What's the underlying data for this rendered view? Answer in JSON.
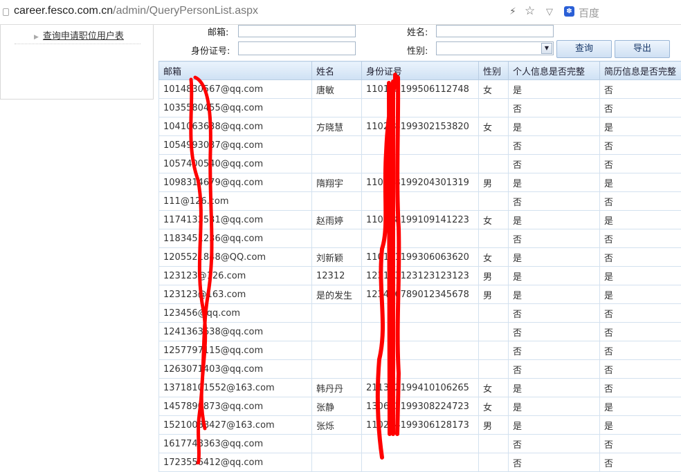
{
  "browser": {
    "url_host": "career.fesco.com.cn",
    "url_path": "/admin/QueryPersonList.aspx",
    "search_engine": "百度",
    "icons": [
      "page-icon",
      "lightning-icon",
      "star-icon",
      "chevron-down-icon",
      "baidu-paw-icon"
    ]
  },
  "sidebar": {
    "items": [
      {
        "label": "查询申请职位用户表"
      }
    ]
  },
  "form": {
    "email_label": "邮箱:",
    "email_value": "",
    "name_label": "姓名:",
    "name_value": "",
    "id_label": "身份证号:",
    "id_value": "",
    "gender_label": "性别:",
    "gender_value": "",
    "query_button": "查询",
    "export_button": "导出"
  },
  "table": {
    "headers": [
      "邮箱",
      "姓名",
      "身份证号",
      "性别",
      "个人信息是否完整",
      "简历信息是否完整"
    ],
    "rows": [
      [
        "1014830567@qq.com",
        "唐敏",
        "110105199506112748",
        "女",
        "是",
        "否"
      ],
      [
        "1035580455@qq.com",
        "",
        "",
        "",
        "否",
        "否"
      ],
      [
        "1041063638@qq.com",
        "方晓慧",
        "110228199302153820",
        "女",
        "是",
        "是"
      ],
      [
        "1054993037@qq.com",
        "",
        "",
        "",
        "否",
        "否"
      ],
      [
        "1057400540@qq.com",
        "",
        "",
        "",
        "否",
        "否"
      ],
      [
        "1098314679@qq.com",
        "隋翔宇",
        "110108199204301319",
        "男",
        "是",
        "是"
      ],
      [
        "111@126.com",
        "",
        "",
        "",
        "否",
        "否"
      ],
      [
        "1174133531@qq.com",
        "赵雨婷",
        "110228199109141223",
        "女",
        "是",
        "是"
      ],
      [
        "1183451236@qq.com",
        "",
        "",
        "",
        "否",
        "否"
      ],
      [
        "1205521848@QQ.com",
        "刘新颖",
        "110111199306063620",
        "女",
        "是",
        "否"
      ],
      [
        "123123@126.com",
        "12312",
        "123123123123123123",
        "男",
        "是",
        "是"
      ],
      [
        "123123@163.com",
        "是的发生",
        "123456789012345678",
        "男",
        "是",
        "是"
      ],
      [
        "123456@qq.com",
        "",
        "",
        "",
        "否",
        "否"
      ],
      [
        "1241363638@qq.com",
        "",
        "",
        "",
        "否",
        "否"
      ],
      [
        "1257797115@qq.com",
        "",
        "",
        "",
        "否",
        "否"
      ],
      [
        "1263071403@qq.com",
        "",
        "",
        "",
        "否",
        "否"
      ],
      [
        "13718101552@163.com",
        "韩丹丹",
        "211382199410106265",
        "女",
        "是",
        "否"
      ],
      [
        "1457890873@qq.com",
        "张静",
        "130682199308224723",
        "女",
        "是",
        "是"
      ],
      [
        "15210088427@163.com",
        "张烁",
        "110224199306128173",
        "男",
        "是",
        "是"
      ],
      [
        "1617748363@qq.com",
        "",
        "",
        "",
        "否",
        "否"
      ],
      [
        "1723556412@qq.com",
        "",
        "",
        "",
        "否",
        "否"
      ]
    ]
  },
  "colors": {
    "header_bg": "#d4e4f6",
    "grid_border": "#d3e1ef",
    "scribble": "#ff0000"
  }
}
